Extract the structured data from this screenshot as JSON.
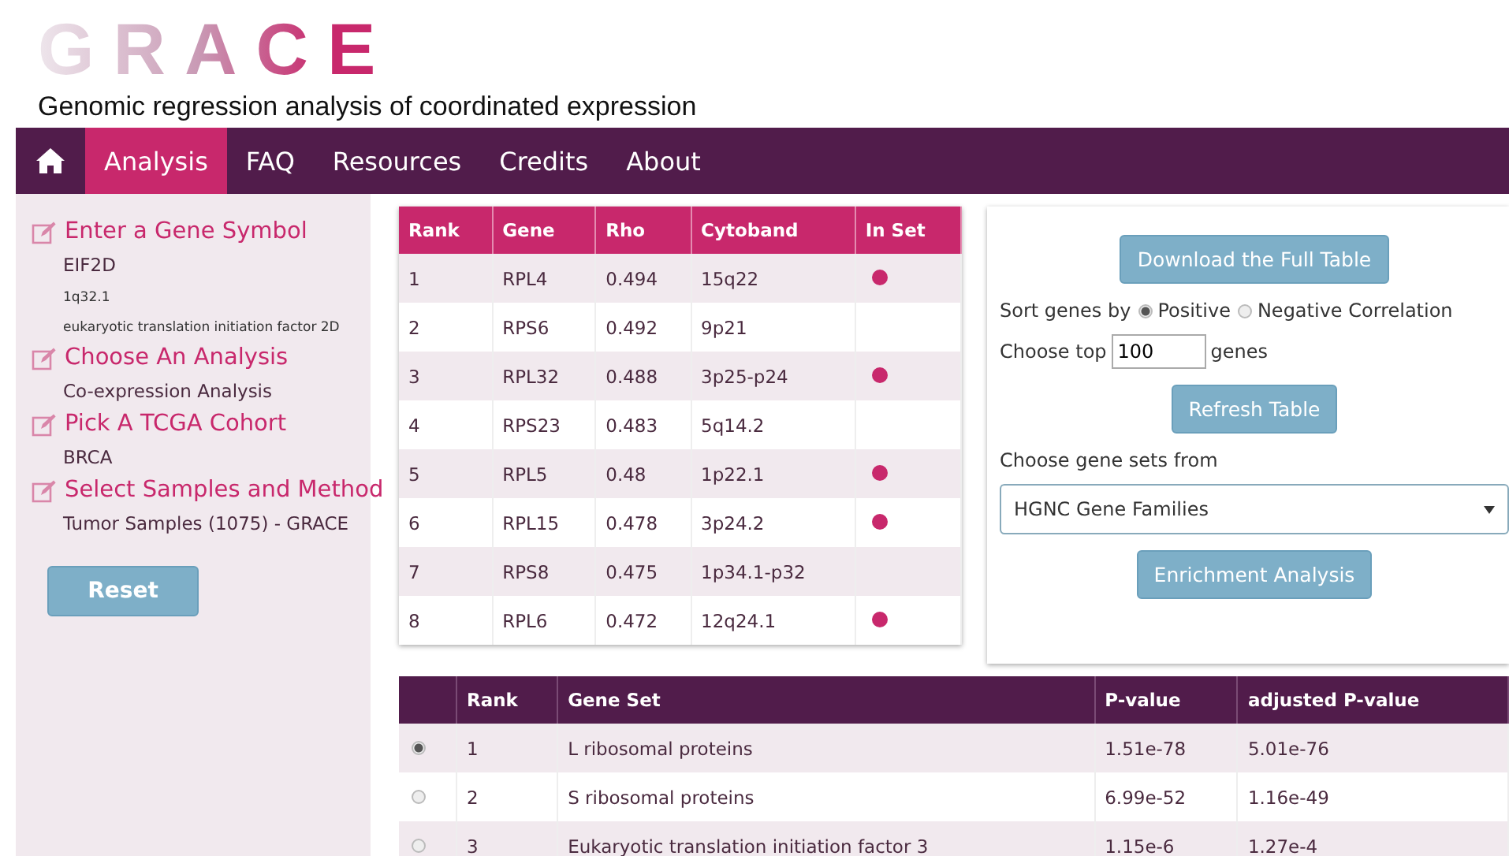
{
  "logo": {
    "title": "GRACE",
    "subtitle": "Genomic regression analysis of coordinated expression"
  },
  "nav": {
    "items": [
      {
        "label": "Analysis",
        "selected": true
      },
      {
        "label": "FAQ",
        "selected": false
      },
      {
        "label": "Resources",
        "selected": false
      },
      {
        "label": "Credits",
        "selected": false
      },
      {
        "label": "About",
        "selected": false
      }
    ]
  },
  "sidebar": {
    "sections": [
      {
        "heading": "Enter a Gene Symbol",
        "lines": [
          {
            "text": "EIF2D",
            "kind": "value"
          },
          {
            "text": "1q32.1",
            "kind": "note"
          },
          {
            "text": "eukaryotic translation initiation factor 2D",
            "kind": "note"
          }
        ]
      },
      {
        "heading": "Choose An Analysis",
        "lines": [
          {
            "text": "Co-expression Analysis",
            "kind": "value"
          }
        ]
      },
      {
        "heading": "Pick A TCGA Cohort",
        "lines": [
          {
            "text": "BRCA",
            "kind": "value"
          }
        ]
      },
      {
        "heading": "Select Samples and Method",
        "lines": [
          {
            "text": "Tumor Samples (1075) - GRACE",
            "kind": "value"
          }
        ]
      }
    ],
    "reset_button": "Reset"
  },
  "gene_table": {
    "columns": [
      "Rank",
      "Gene",
      "Rho",
      "Cytoband",
      "In Set"
    ],
    "rows": [
      {
        "rank": "1",
        "gene": "RPL4",
        "rho": "0.494",
        "cytoband": "15q22",
        "in_set": true
      },
      {
        "rank": "2",
        "gene": "RPS6",
        "rho": "0.492",
        "cytoband": "9p21",
        "in_set": false
      },
      {
        "rank": "3",
        "gene": "RPL32",
        "rho": "0.488",
        "cytoband": "3p25-p24",
        "in_set": true
      },
      {
        "rank": "4",
        "gene": "RPS23",
        "rho": "0.483",
        "cytoband": "5q14.2",
        "in_set": false
      },
      {
        "rank": "5",
        "gene": "RPL5",
        "rho": "0.48",
        "cytoband": "1p22.1",
        "in_set": true
      },
      {
        "rank": "6",
        "gene": "RPL15",
        "rho": "0.478",
        "cytoband": "3p24.2",
        "in_set": true
      },
      {
        "rank": "7",
        "gene": "RPS8",
        "rho": "0.475",
        "cytoband": "1p34.1-p32",
        "in_set": false
      },
      {
        "rank": "8",
        "gene": "RPL6",
        "rho": "0.472",
        "cytoband": "12q24.1",
        "in_set": true
      }
    ]
  },
  "controls": {
    "download_button": "Download the Full Table",
    "sort_label": "Sort genes by",
    "sort_options": [
      {
        "label": "Positive",
        "selected": true
      },
      {
        "label": "Negative Correlation",
        "selected": false
      }
    ],
    "top_label": "Choose top",
    "top_value": "100",
    "top_suffix": "genes",
    "refresh_button": "Refresh Table",
    "gene_sets_label": "Choose gene sets from",
    "gene_sets_value": "HGNC Gene Families",
    "enrichment_button": "Enrichment Analysis"
  },
  "enrichment_table": {
    "columns": [
      "Rank",
      "Gene Set",
      "P-value",
      "adjusted P-value"
    ],
    "rows": [
      {
        "selected": true,
        "rank": "1",
        "gene_set": "L ribosomal proteins",
        "p_value": "1.51e-78",
        "adjusted_p_value": "5.01e-76"
      },
      {
        "selected": false,
        "rank": "2",
        "gene_set": "S ribosomal proteins",
        "p_value": "6.99e-52",
        "adjusted_p_value": "1.16e-49"
      },
      {
        "selected": false,
        "rank": "3",
        "gene_set": "Eukaryotic translation initiation factor 3",
        "p_value": "1.15e-6",
        "adjusted_p_value": "1.27e-4"
      }
    ]
  }
}
